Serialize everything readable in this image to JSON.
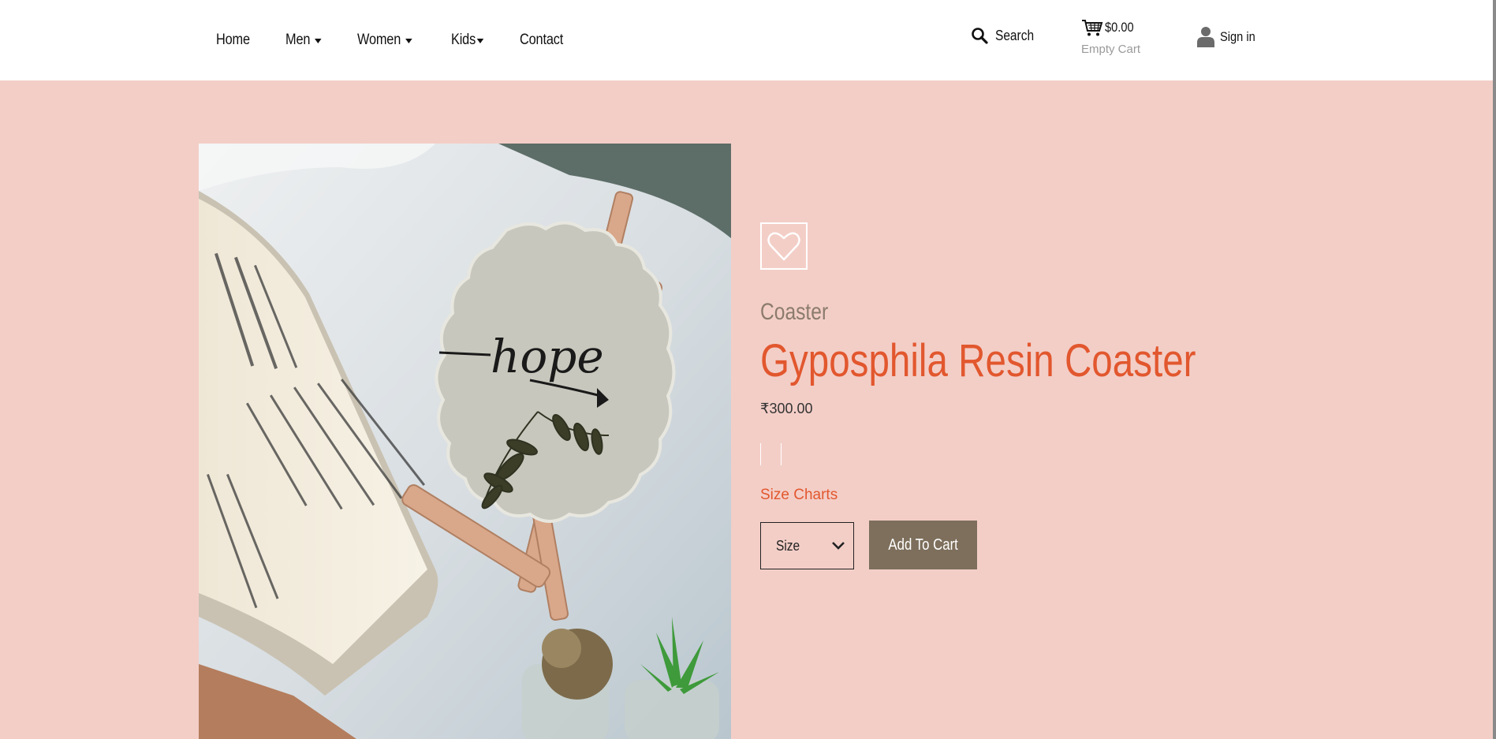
{
  "nav": {
    "items": [
      {
        "label": "Home",
        "dropdown": false
      },
      {
        "label": "Men",
        "dropdown": true
      },
      {
        "label": "Women",
        "dropdown": true
      },
      {
        "label": "Kids",
        "dropdown": true
      },
      {
        "label": "Contact",
        "dropdown": false
      }
    ]
  },
  "header": {
    "search_label": "Search",
    "cart_amount": "$0.00",
    "cart_status": "Empty Cart",
    "signin_label": "Sign in"
  },
  "product": {
    "category": "Coaster",
    "title": "Gyposphila Resin Coaster",
    "price": "₹300.00",
    "size_charts_label": "Size Charts",
    "size_select_value": "Size",
    "add_to_cart_label": "Add To Cart",
    "image_text": "hope"
  },
  "colors": {
    "page_bg": "#f3cec7",
    "accent": "#e2572e",
    "button_bg": "#7d6f5c",
    "category_text": "#8b7b6d"
  },
  "icons": [
    "search-icon",
    "cart-icon",
    "user-icon",
    "heart-icon",
    "chevron-down-icon"
  ]
}
